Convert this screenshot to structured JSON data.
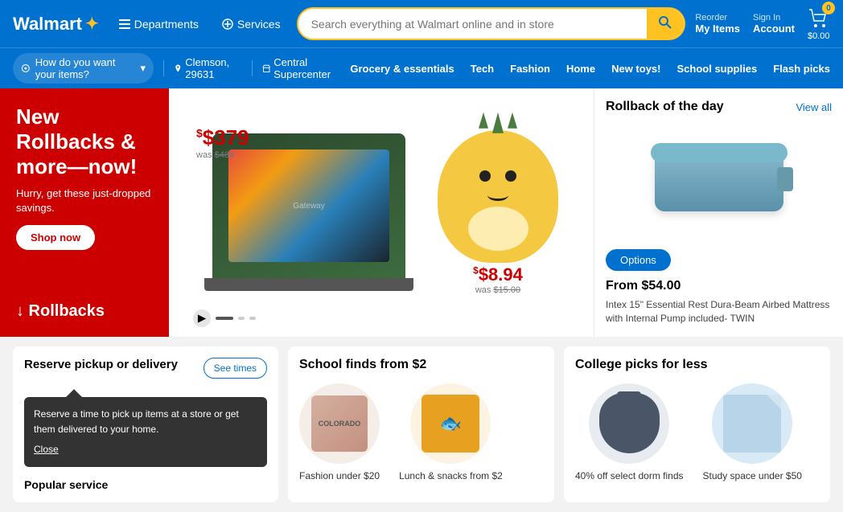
{
  "header": {
    "logo": "Walmart",
    "spark": "✦",
    "departments_label": "Departments",
    "services_label": "Services",
    "search_placeholder": "Search everything at Walmart online and in store",
    "reorder_label": "Reorder",
    "reorder_sub": "My Items",
    "signin_label": "Sign In",
    "signin_sub": "Account",
    "cart_count": "0",
    "cart_price": "$0.00"
  },
  "subheader": {
    "delivery_label": "How do you want your items?",
    "location": "Clemson, 29631",
    "store": "Central Supercenter",
    "nav_links": [
      {
        "label": "Grocery & essentials"
      },
      {
        "label": "Tech"
      },
      {
        "label": "Fashion"
      },
      {
        "label": "Home"
      },
      {
        "label": "New toys!"
      },
      {
        "label": "School supplies"
      },
      {
        "label": "Flash picks"
      }
    ]
  },
  "hero": {
    "red_heading": "New Rollbacks & more—now!",
    "red_subtext": "Hurry, get these just-dropped savings.",
    "shop_now": "Shop now",
    "rollbacks_label": "↓ Rollbacks",
    "laptop_price": "$379",
    "laptop_was": "$489",
    "squishmallow_price": "$8.94",
    "squishmallow_was": "$15.00"
  },
  "rollback_sidebar": {
    "title": "Rollback of the day",
    "view_all": "View all",
    "options_btn": "Options",
    "from_price": "From $54.00",
    "product_name": "Intex 15\" Essential Rest Dura-Beam Airbed Mattress with Internal Pump included- TWIN"
  },
  "bottom": {
    "pickup": {
      "title": "Reserve pickup or delivery",
      "see_times": "See times",
      "tooltip_text": "Reserve a time to pick up items at a store or get them delivered to your home.",
      "close": "Close"
    },
    "school": {
      "title": "School finds from $2",
      "items": [
        {
          "label": "Fashion under $20"
        },
        {
          "label": "Lunch & snacks from $2"
        }
      ]
    },
    "college": {
      "title": "College picks for less",
      "items": [
        {
          "label": "40% off select dorm finds"
        },
        {
          "label": "Study space under $50"
        }
      ]
    },
    "popular_services": "Popular service"
  }
}
